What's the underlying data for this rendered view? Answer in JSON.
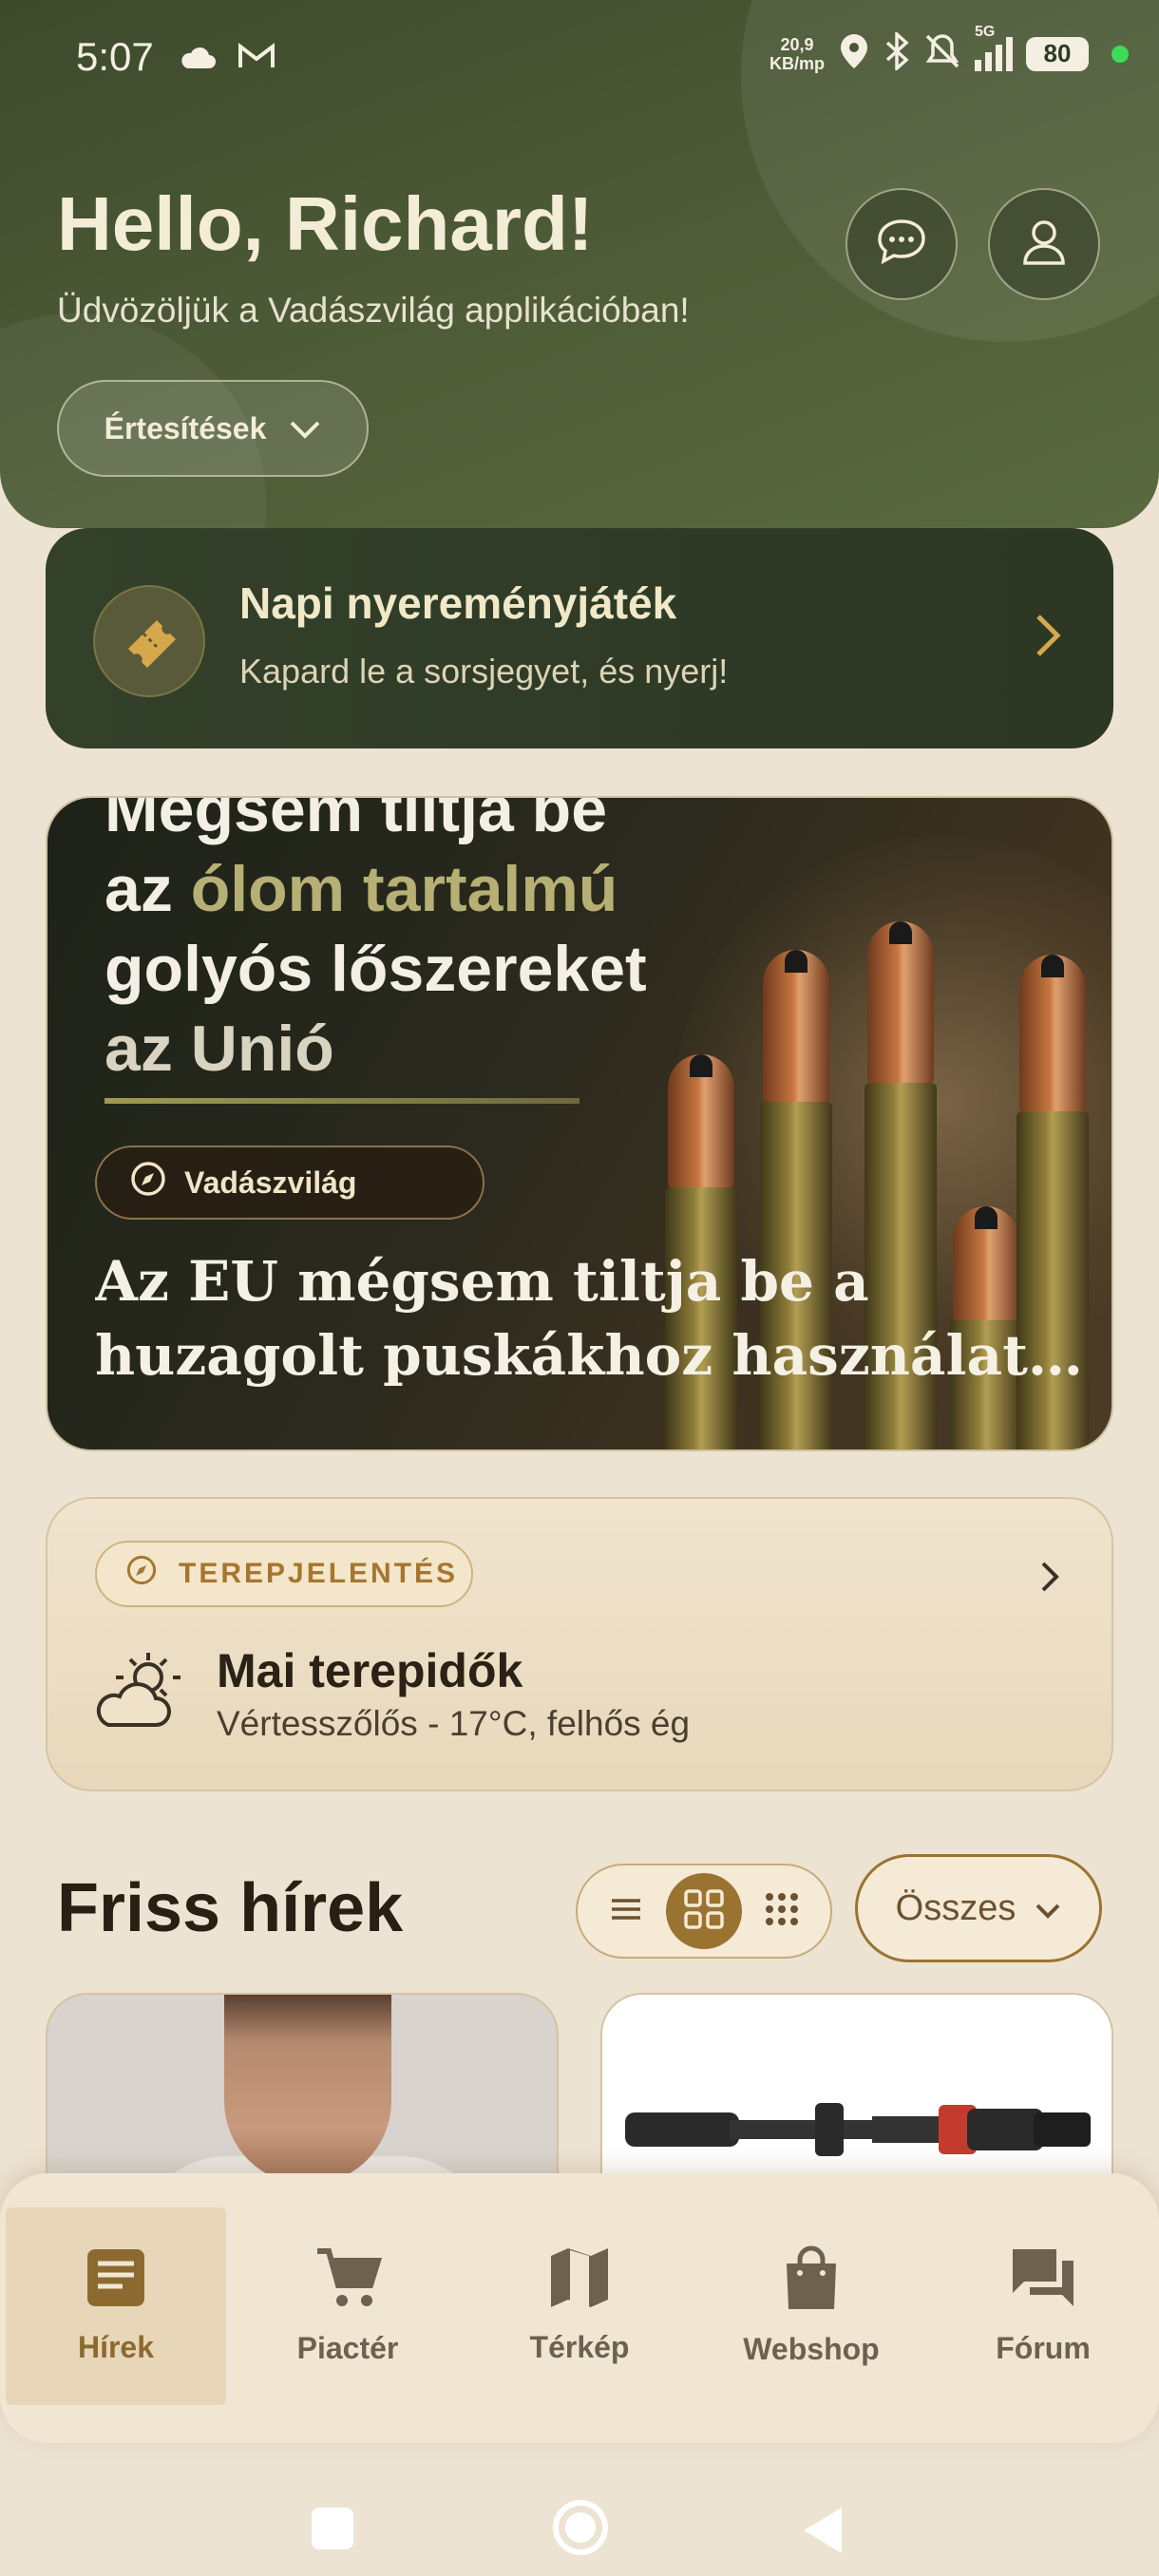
{
  "status_bar": {
    "time": "5:07",
    "speed_value": "20,9",
    "speed_unit": "KB/mp",
    "network": "5G",
    "battery": "80",
    "icons": [
      "cloud-icon",
      "gmail-icon",
      "location-icon",
      "bluetooth-icon",
      "mute-icon",
      "signal-icon"
    ]
  },
  "header": {
    "greeting": "Hello, Richard!",
    "welcome": "Üdvözöljük a Vadászvilág applikációban!",
    "notifications_label": "Értesítések",
    "colors": {
      "header_bg": "#4f5d38",
      "accent": "#9a7331"
    }
  },
  "lottery": {
    "title": "Napi nyereményjáték",
    "subtitle": "Kapard le a sorsjegyet, és nyerj!"
  },
  "hero": {
    "headline_line1": "Mégsem tiltja be",
    "headline_line2_prefix": "az ",
    "headline_line2_highlight": "ólom tartalmú",
    "headline_line3": "golyós lőszereket",
    "headline_line4": "az Unió",
    "source": "Vadászvilág",
    "title_line1": "Az EU mégsem tiltja be a",
    "title_line2": "huzagolt puskákhoz használato..."
  },
  "report": {
    "chip": "TEREPJELENTÉS",
    "title": "Mai terepidők",
    "subtitle": "Vértesszőlős - 17°C, felhős ég"
  },
  "news": {
    "title": "Friss hírek",
    "filter_label": "Összes",
    "view_modes": [
      "list",
      "grid",
      "compact-grid"
    ],
    "active_view": "grid"
  },
  "bottom_nav": {
    "items": [
      {
        "label": "Hírek",
        "icon": "article-icon",
        "active": true
      },
      {
        "label": "Piactér",
        "icon": "cart-icon",
        "active": false
      },
      {
        "label": "Térkép",
        "icon": "map-icon",
        "active": false
      },
      {
        "label": "Webshop",
        "icon": "shopping-bag-icon",
        "active": false
      },
      {
        "label": "Fórum",
        "icon": "forum-icon",
        "active": false
      }
    ]
  }
}
